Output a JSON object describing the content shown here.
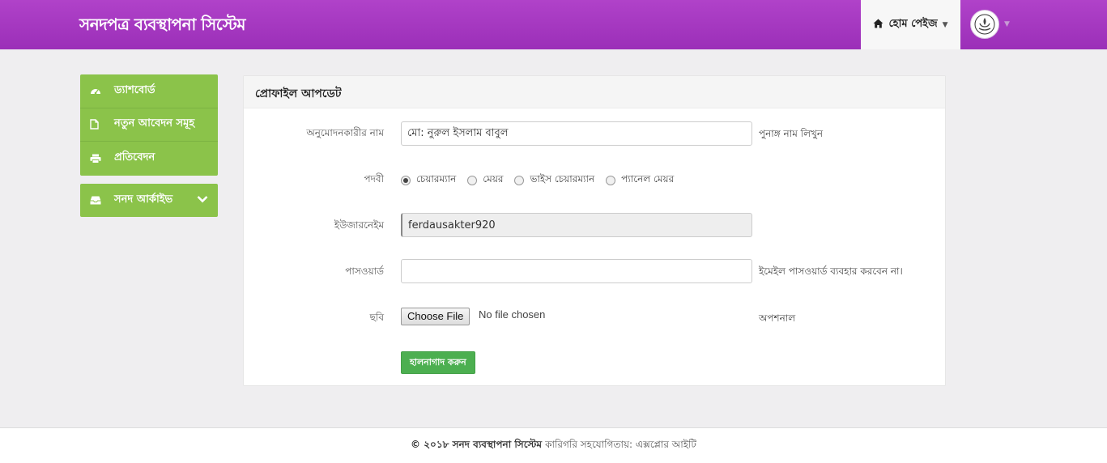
{
  "header": {
    "brand": "সনদপত্র ব্যবস্থাপনা সিস্টেম",
    "home_label": "হোম পেইজ",
    "home_icon": "home-icon",
    "avatar_icon": "emblem-logo"
  },
  "sidebar": {
    "items": [
      {
        "label": "ড্যাশবোর্ড",
        "icon": "dashboard-icon"
      },
      {
        "label": "নতুন আবেদন সমূহ",
        "icon": "file-icon"
      },
      {
        "label": "প্রতিবেদন",
        "icon": "print-icon"
      }
    ],
    "archive": {
      "label": "সনদ আর্কাইভ",
      "icon": "inbox-icon"
    }
  },
  "panel": {
    "title": "প্রোফাইল আপডেট",
    "fields": {
      "approver": {
        "label": "অনুমোদনকারীর নাম",
        "value": "মো: নুরুল ইসলাম বাবুল",
        "help": "পুনাঙ্গ নাম লিখুন"
      },
      "designation": {
        "label": "পদবী",
        "options": [
          "চেয়ারম্যান",
          "মেয়র",
          "ভাইস চেয়ারম্যান",
          "প্যানেল মেয়র"
        ],
        "selected": "চেয়ারম্যান"
      },
      "username": {
        "label": "ইউজারনেইম",
        "value": "ferdausakter920"
      },
      "password": {
        "label": "পাসওয়ার্ড",
        "value": "",
        "help": "ইমেইল পাসওয়ার্ড ব্যবহার করবেন না।"
      },
      "photo": {
        "label": "ছবি",
        "button": "Choose File",
        "status": "No file chosen",
        "help": "অপশনাল"
      }
    },
    "submit_label": "হালনাগাদ করুন"
  },
  "footer": {
    "copyright": "© ২০১৮ সনদ ব্যবস্থাপনা সিস্টেম",
    "credit": "কারিগরি সহযোগিতায়: এক্সপ্লোর আইটি"
  },
  "colors": {
    "navbar": "#a63bc2",
    "sidebar": "#8bc34a",
    "submit": "#4caf50"
  }
}
